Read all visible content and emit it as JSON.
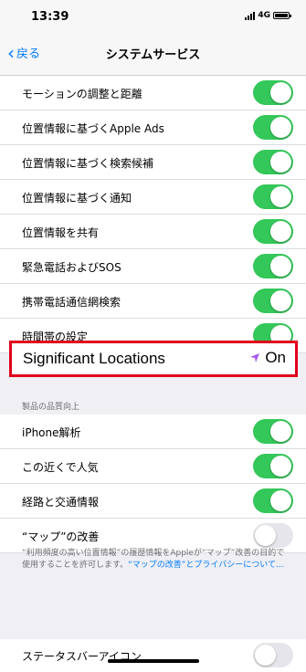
{
  "status": {
    "time": "13:39",
    "network": "4G"
  },
  "nav": {
    "back": "戻る",
    "title": "システムサービス"
  },
  "rows": [
    {
      "label": "モーションの調整と距離",
      "arrow": "gray"
    },
    {
      "label": "位置情報に基づくApple Ads",
      "arrow": "none"
    },
    {
      "label": "位置情報に基づく検索候補",
      "arrow": "purple"
    },
    {
      "label": "位置情報に基づく通知",
      "arrow": "purple"
    },
    {
      "label": "位置情報を共有",
      "arrow": "none"
    },
    {
      "label": "緊急電話およびSOS",
      "arrow": "none"
    },
    {
      "label": "携帯電話通信網検索",
      "arrow": "gray"
    },
    {
      "label": "時間帯の設定",
      "arrow": "gray"
    }
  ],
  "significant": {
    "label": "Significant Locations",
    "value": "On"
  },
  "section_header": "製品の品質向上",
  "rows2": [
    {
      "label": "iPhone解析",
      "arrow": "gray",
      "on": true
    },
    {
      "label": "この近くで人気",
      "arrow": "gray",
      "on": true
    },
    {
      "label": "経路と交通情報",
      "arrow": "gray",
      "on": true
    },
    {
      "label": "“マップ”の改善",
      "arrow": "none",
      "on": false
    }
  ],
  "footer": {
    "text": "“利用頻度の高い位置情報”の履歴情報をAppleが“マップ”改善の目的で使用することを許可します。",
    "link": "“マップの改善”とプライバシーについて..."
  },
  "status_bar_icon_row": {
    "label": "ステータスバーアイコン"
  },
  "colors": {
    "accent": "#007aff",
    "toggle_on": "#34c759",
    "highlight": "#e0001b",
    "arrow_purple": "#a55af0",
    "arrow_gray": "#8e8e93"
  }
}
